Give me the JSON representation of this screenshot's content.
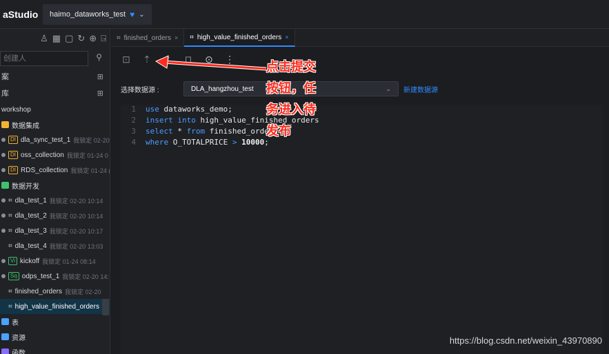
{
  "header": {
    "brand": "aStudio",
    "workspace": "haimo_dataworks_test"
  },
  "sidebar": {
    "search_placeholder": "创建人",
    "sections": [
      "案",
      "库"
    ],
    "root": "workshop",
    "items": [
      {
        "label": "数据集成",
        "kind": "folder",
        "color": "#f2b233"
      },
      {
        "label": "dla_sync_test_1",
        "tag": "DI",
        "meta": "我锁定 02-20",
        "dot": true
      },
      {
        "label": "oss_collection",
        "tag": "DI",
        "meta": "我锁定 01-24 0",
        "dot": true
      },
      {
        "label": "RDS_collection",
        "tag": "DI",
        "meta": "我锁定 01-24 (",
        "dot": true
      },
      {
        "label": "数据开发",
        "kind": "folder",
        "color": "#3fc26b"
      },
      {
        "label": "dla_test_1",
        "meta": "我锁定 02-20 10:14",
        "dot": true,
        "branch": true
      },
      {
        "label": "dla_test_2",
        "meta": "我锁定 02-20 10:14",
        "dot": true,
        "branch": true
      },
      {
        "label": "dla_test_3",
        "meta": "我锁定 02-20 10:17",
        "dot": true,
        "branch": true
      },
      {
        "label": "dla_test_4",
        "meta": "我锁定 02-20 13:03",
        "dot": false,
        "branch": true
      },
      {
        "label": "kickoff",
        "tag": "Vi",
        "meta": "我锁定 01-24 08:14",
        "dot": true
      },
      {
        "label": "odps_test_1",
        "tag": "Sq",
        "meta": "我锁定 02-20 14:",
        "dot": true
      },
      {
        "label": "finished_orders",
        "meta": "我锁定 02-20",
        "dot": false,
        "branch": true
      },
      {
        "label": "high_value_finished_orders",
        "meta": "",
        "dot": false,
        "branch": true,
        "active": true
      },
      {
        "label": "表",
        "kind": "folder",
        "color": "#4aa3ff"
      },
      {
        "label": "资源",
        "kind": "folder",
        "color": "#4aa3ff"
      },
      {
        "label": "函数",
        "kind": "folder",
        "color": "#8a6cff"
      }
    ]
  },
  "tabs": [
    {
      "label": "finished_orders",
      "active": false
    },
    {
      "label": "high_value_finished_orders",
      "active": true
    }
  ],
  "datasource": {
    "label": "选择数据源 :",
    "value": "DLA_hangzhou_test",
    "new_link": "新建数据源"
  },
  "code": [
    {
      "n": "1",
      "tokens": [
        [
          "kw",
          "use "
        ],
        [
          "id",
          "dataworks_demo;"
        ]
      ]
    },
    {
      "n": "2",
      "tokens": [
        [
          "kw",
          "insert into "
        ],
        [
          "id",
          "high_value_finished_orders"
        ]
      ]
    },
    {
      "n": "3",
      "tokens": [
        [
          "kw",
          "select "
        ],
        [
          "id",
          "* "
        ],
        [
          "kw",
          "from "
        ],
        [
          "id",
          "finished_orders"
        ]
      ]
    },
    {
      "n": "4",
      "tokens": [
        [
          "kw",
          "where "
        ],
        [
          "id",
          "O_TOTALPRICE "
        ],
        [
          "kw",
          "> "
        ],
        [
          "num",
          "10000"
        ],
        [
          "id",
          ";"
        ]
      ]
    }
  ],
  "annotation": {
    "lines": [
      "点击提交",
      "按钮，任",
      "务进入待",
      "发布"
    ]
  },
  "watermark": "https://blog.csdn.net/weixin_43970890"
}
